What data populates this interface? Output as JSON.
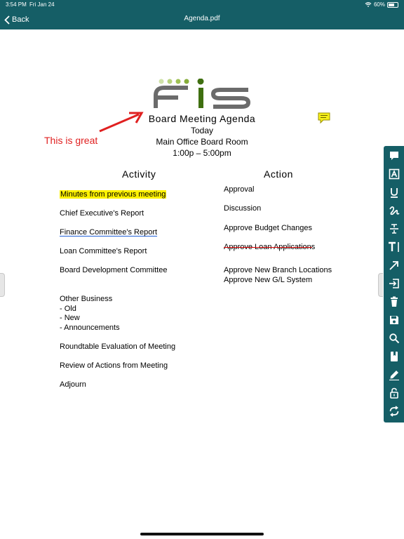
{
  "status_bar": {
    "time": "3:54 PM",
    "date": "Fri Jan 24",
    "battery": "60%"
  },
  "nav": {
    "back_label": "Back",
    "title": "Agenda.pdf"
  },
  "document": {
    "logo_text": "FIS",
    "title": "Board Meeting Agenda",
    "lines": [
      "Today",
      "Main Office Board Room",
      "1:00p – 5:00pm"
    ],
    "annotation_text": "This is great",
    "activity_header": "Activity",
    "action_header": "Action",
    "activity_items": [
      "Minutes from previous meeting",
      "Chief Executive's Report",
      "Finance Committee's Report",
      "Loan Committee's Report",
      "Board Development Committee",
      "Other Business",
      "- Old",
      "- New",
      "- Announcements",
      "Roundtable Evaluation of Meeting",
      "Review of Actions from Meeting",
      "Adjourn"
    ],
    "action_items": [
      "Approval",
      "Discussion",
      "Approve Budget Changes",
      "Approve Loan Applications",
      "Approve New Branch Locations",
      "Approve New G/L System"
    ]
  },
  "colors": {
    "brand": "#155e66",
    "highlight": "#fff200",
    "annotation": "#e02020",
    "underline": "#1f5fd6"
  },
  "toolbar_icons": [
    "comment-icon",
    "text-box-icon",
    "underline-icon",
    "freehand-icon",
    "strikethrough-icon",
    "text-insert-icon",
    "arrow-icon",
    "import-icon",
    "trash-icon",
    "save-icon",
    "search-icon",
    "bookmark-icon",
    "pen-icon",
    "lock-icon",
    "sync-icon"
  ]
}
